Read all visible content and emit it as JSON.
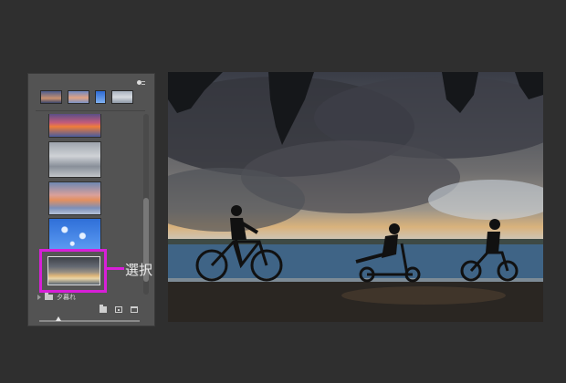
{
  "panel": {
    "folder_label": "夕暮れ",
    "callout_label": "選択"
  },
  "colors": {
    "highlight": "#d81fd8",
    "panel_bg": "#535353",
    "page_bg": "#2f2f2f"
  },
  "icons": [
    "panel-menu-icon",
    "folder-icon",
    "new-folder-icon",
    "new-sky-icon",
    "trash-icon",
    "expand-caret-icon",
    "slider-handle-icon"
  ]
}
